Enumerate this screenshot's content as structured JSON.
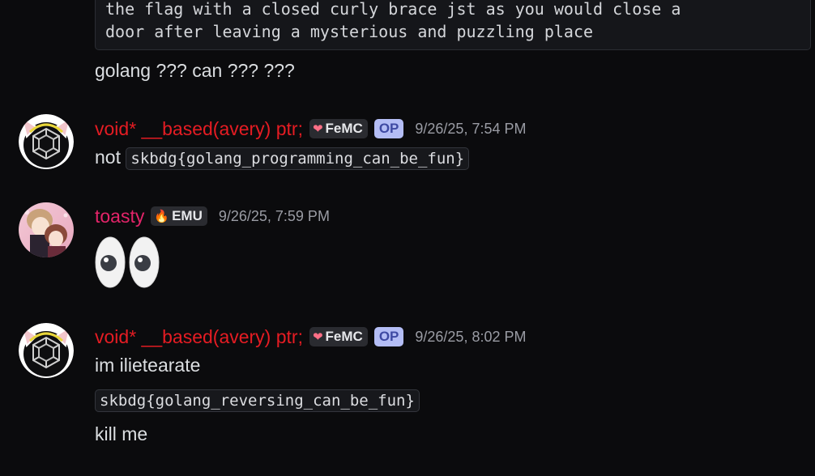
{
  "code_block": {
    "line1": "the flag with a closed curly brace jst as you would close a",
    "line2": "door after leaving a mysterious and puzzling place"
  },
  "messages": [
    {
      "text": "golang ??? can ??? ???"
    },
    {
      "username": "void* __based(avery) ptr;",
      "tag": "FeMC",
      "op": "OP",
      "timestamp": "9/26/25, 7:54 PM",
      "text_prefix": "not",
      "code": "skbdg{golang_programming_can_be_fun}"
    },
    {
      "username": "toasty",
      "tag": "EMU",
      "timestamp": "9/26/25, 7:59 PM",
      "emoji": "eyes"
    },
    {
      "username": "void* __based(avery) ptr;",
      "tag": "FeMC",
      "op": "OP",
      "timestamp": "9/26/25, 8:02 PM",
      "line1": "im ilietearate",
      "code": "skbdg{golang_reversing_can_be_fun}",
      "line3": "kill me"
    }
  ],
  "icons": {
    "femc_tag": "heart-icon",
    "emu_tag": "flame-icon"
  },
  "colors": {
    "background": "#0b0b0d",
    "void_username": "#e51c23",
    "toasty_username": "#e32469",
    "op_badge_bg": "#b4bdf5",
    "op_badge_text": "#3f4aa3",
    "timestamp": "#9a9ca4"
  }
}
